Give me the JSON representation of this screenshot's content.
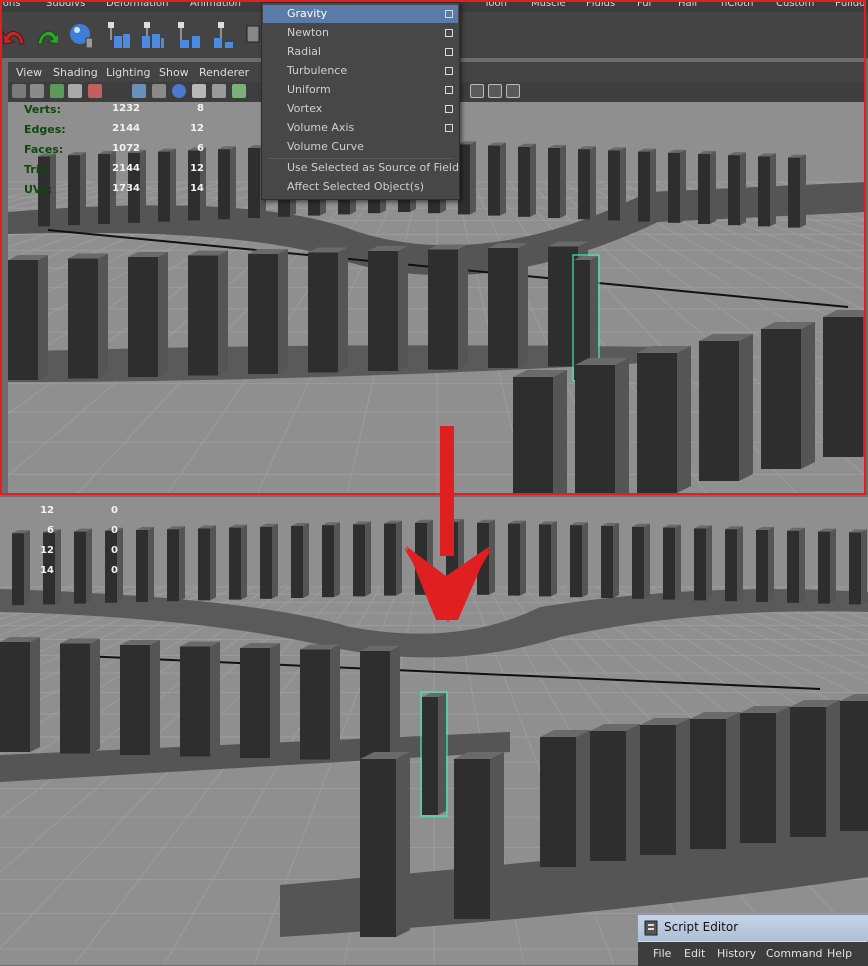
{
  "main_menu": [
    "ions",
    "Subdivs",
    "Deformation",
    "Animation",
    "Toon",
    "Muscle",
    "Fluids",
    "Fur",
    "Hair",
    "nCloth",
    "Custom",
    "Pulldo"
  ],
  "panel_menu": [
    "View",
    "Shading",
    "Lighting",
    "Show",
    "Renderer"
  ],
  "fields_menu": {
    "items": [
      "Gravity",
      "Newton",
      "Radial",
      "Turbulence",
      "Uniform",
      "Vortex",
      "Volume Axis",
      "Volume Curve"
    ],
    "actions": [
      "Use Selected as Source of Field",
      "Affect Selected Object(s)"
    ],
    "selected": "Gravity"
  },
  "hud_top": {
    "labels": [
      "Verts:",
      "Edges:",
      "Faces:",
      "Tris:",
      "UVs:"
    ],
    "col1": [
      "1232",
      "2144",
      "1072",
      "2144",
      "1734"
    ],
    "col2": [
      "8",
      "12",
      "6",
      "12",
      "14"
    ]
  },
  "hud_bottom": {
    "col1": [
      "12",
      "6",
      "12",
      "14"
    ],
    "col2": [
      "0",
      "0",
      "0",
      "0"
    ]
  },
  "script_editor": {
    "title": "Script Editor",
    "menu": [
      "File",
      "Edit",
      "History",
      "Command",
      "Help"
    ]
  },
  "colors": {
    "highlight": "#5a7ba8",
    "selection_outline": "#3cf0b0",
    "annotation_red": "#e02020",
    "hud_label": "#0b4a0b"
  }
}
